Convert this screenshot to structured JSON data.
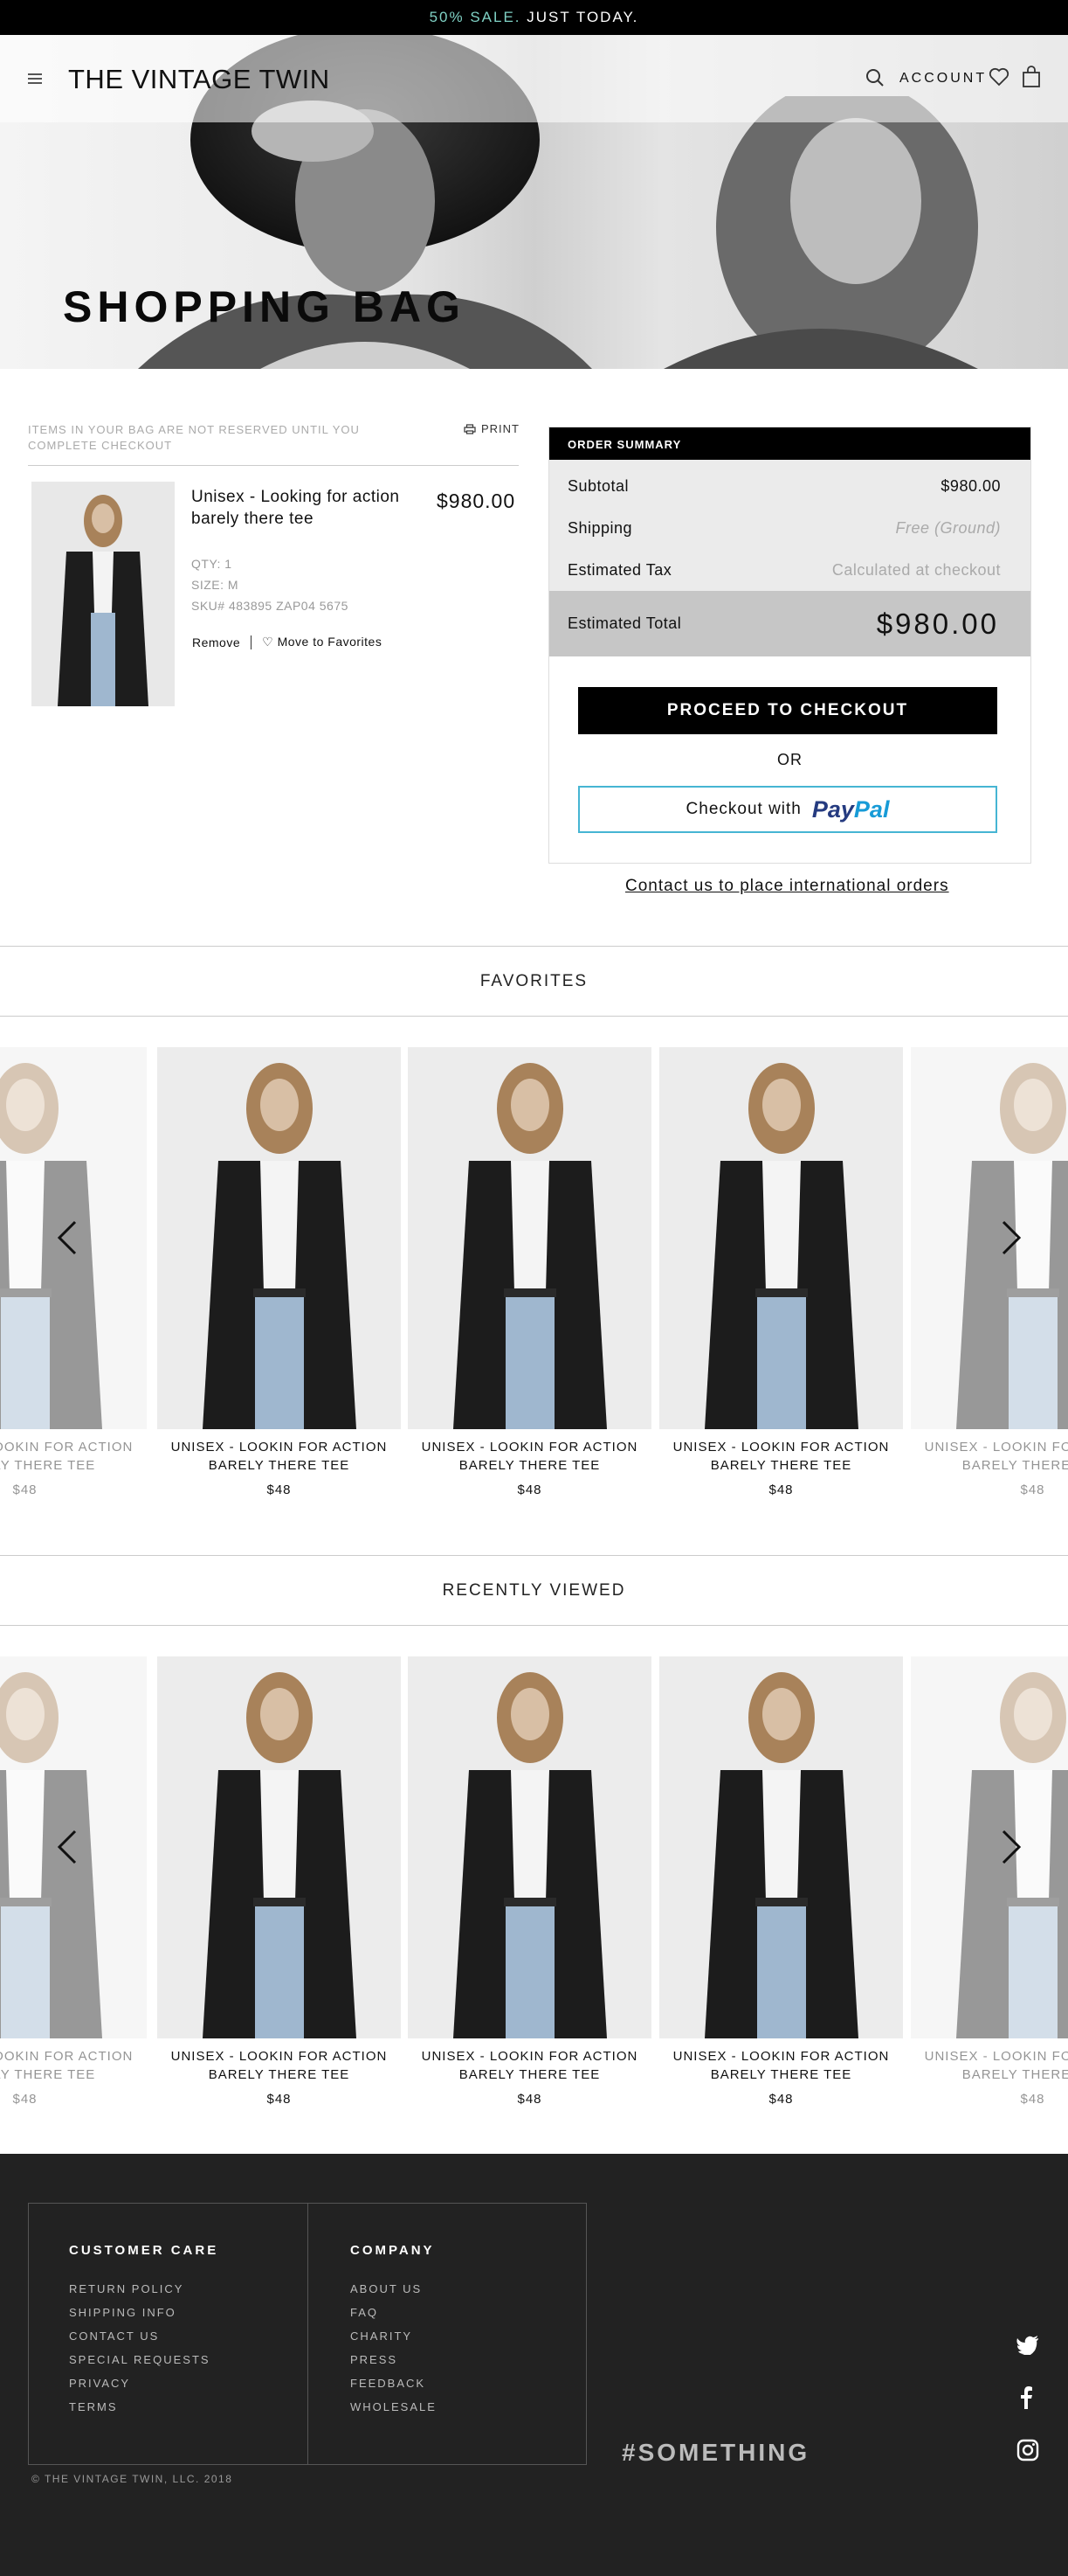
{
  "promo": {
    "highlight": "50% SALE.",
    "text": "JUST TODAY.",
    "accent_color": "#7fd1c4"
  },
  "header": {
    "logo": "THE VINTAGE TWIN",
    "account_label": "ACCOUNT",
    "icons": [
      "menu-icon",
      "search-icon",
      "heart-icon",
      "bag-icon"
    ]
  },
  "hero": {
    "title": "SHOPPING BAG"
  },
  "bag": {
    "note": "ITEMS IN YOUR BAG ARE NOT RESERVED UNTIL YOU COMPLETE CHECKOUT",
    "print_label": "PRINT",
    "item": {
      "name": "Unisex - Looking for action barely there tee",
      "price": "$980.00",
      "qty": "QTY: 1",
      "size": "SIZE: M",
      "sku": "SKU# 483895 ZAP04 5675",
      "remove_label": "Remove",
      "favorite_label": "♡ Move to Favorites"
    }
  },
  "summary": {
    "heading": "ORDER SUMMARY",
    "rows": [
      {
        "label": "Subtotal",
        "value": "$980.00"
      },
      {
        "label": "Shipping",
        "value": "Free (Ground)"
      },
      {
        "label": "Estimated Tax",
        "value": "Calculated at checkout"
      }
    ],
    "total_label": "Estimated Total",
    "total_value": "$980.00",
    "checkout_label": "PROCEED TO CHECKOUT",
    "or_label": "OR",
    "paypal_prefix": "Checkout with",
    "paypal_pay": "Pay",
    "paypal_pal": "Pal",
    "paypal_border_color": "#46b5d3",
    "international_link": "Contact us to place international orders"
  },
  "favorites": {
    "title": "FAVORITES",
    "items": [
      {
        "name_line1": "UNISEX - LOOKIN FOR ACTION",
        "name_line2": "BARELY THERE TEE",
        "price": "$48"
      },
      {
        "name_line1": "UNISEX - LOOKIN FOR ACTION",
        "name_line2": "BARELY THERE TEE",
        "price": "$48"
      },
      {
        "name_line1": "UNISEX - LOOKIN FOR ACTION",
        "name_line2": "BARELY THERE TEE",
        "price": "$48"
      },
      {
        "name_line1": "UNISEX - LOOKIN FOR ACTION",
        "name_line2": "BARELY THERE TEE",
        "price": "$48"
      },
      {
        "name_line1": "UNISEX - LOOKIN FOR ACTION",
        "name_line2": "BARELY THERE TEE",
        "price": "$48"
      }
    ]
  },
  "recently_viewed": {
    "title": "RECENTLY VIEWED",
    "items": [
      {
        "name_line1": "UNISEX - LOOKIN FOR ACTION",
        "name_line2": "BARELY THERE TEE",
        "price": "$48"
      },
      {
        "name_line1": "UNISEX - LOOKIN FOR ACTION",
        "name_line2": "BARELY THERE TEE",
        "price": "$48"
      },
      {
        "name_line1": "UNISEX - LOOKIN FOR ACTION",
        "name_line2": "BARELY THERE TEE",
        "price": "$48"
      },
      {
        "name_line1": "UNISEX - LOOKIN FOR ACTION",
        "name_line2": "BARELY THERE TEE",
        "price": "$48"
      },
      {
        "name_line1": "UNISEX - LOOKIN FOR ACTION",
        "name_line2": "BARELY THERE TEE",
        "price": "$48"
      }
    ]
  },
  "footer": {
    "customer_care": {
      "heading": "CUSTOMER CARE",
      "links": [
        "RETURN POLICY",
        "SHIPPING INFO",
        "CONTACT US",
        "SPECIAL REQUESTS",
        "PRIVACY",
        "TERMS"
      ]
    },
    "company": {
      "heading": "COMPANY",
      "links": [
        "ABOUT US",
        "FAQ",
        "CHARITY",
        "PRESS",
        "FEEDBACK",
        "WHOLESALE"
      ]
    },
    "hashtag": "#SOMETHING",
    "social_icons": [
      "twitter-icon",
      "facebook-icon",
      "instagram-icon"
    ],
    "copyright": "© THE VINTAGE TWIN, LLC. 2018"
  }
}
